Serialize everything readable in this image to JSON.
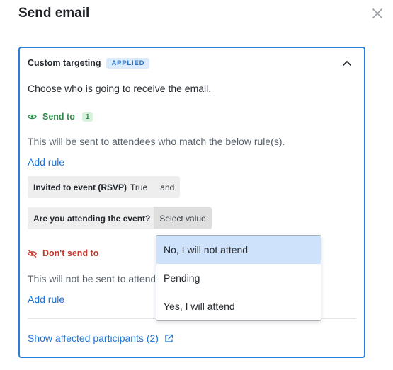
{
  "modal": {
    "title": "Send email"
  },
  "targeting": {
    "title": "Custom targeting",
    "badge": "APPLIED",
    "intro": "Choose who is going to receive the email.",
    "send_to": {
      "label": "Send to",
      "count": "1",
      "description": "This will be sent to attendees who match the below rule(s).",
      "add_rule": "Add rule",
      "rules": [
        {
          "label": "Invited to event (RSVP)",
          "value": "True",
          "connector": "and"
        },
        {
          "label": "Are you attending the event?",
          "select": "Select value"
        }
      ]
    },
    "dont_send_to": {
      "label": "Don't send to",
      "description": "This will not be sent to attendees who match the below rule(s).",
      "add_rule": "Add rule"
    },
    "show_affected": "Show affected participants (2)"
  },
  "dropdown": {
    "options": [
      "No, I will not attend",
      "Pending",
      "Yes, I will attend"
    ],
    "highlighted": 0
  },
  "colors": {
    "accent": "#2a7fd8",
    "link": "#1f74d4",
    "send_green": "#2e8a4a",
    "dont_red": "#c2392b",
    "highlight": "#cfe2fc"
  }
}
